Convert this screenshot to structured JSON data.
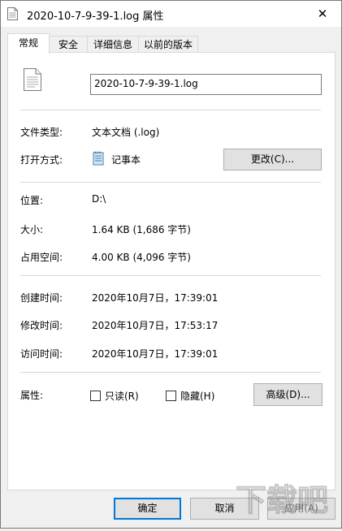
{
  "window": {
    "title": "2020-10-7-9-39-1.log 属性",
    "close_glyph": "✕"
  },
  "tabs": [
    {
      "label": "常规",
      "active": true
    },
    {
      "label": "安全",
      "active": false
    },
    {
      "label": "详细信息",
      "active": false
    },
    {
      "label": "以前的版本",
      "active": false
    }
  ],
  "general": {
    "file_name": "2020-10-7-9-39-1.log",
    "file_type_label": "文件类型:",
    "file_type_value": "文本文档 (.log)",
    "opens_with_label": "打开方式:",
    "opens_with_value": "记事本",
    "change_button": "更改(C)...",
    "location_label": "位置:",
    "location_value": "D:\\",
    "size_label": "大小:",
    "size_value": "1.64 KB (1,686 字节)",
    "size_on_disk_label": "占用空间:",
    "size_on_disk_value": "4.00 KB (4,096 字节)",
    "created_label": "创建时间:",
    "created_value": "2020年10月7日，17:39:01",
    "modified_label": "修改时间:",
    "modified_value": "2020年10月7日，17:53:17",
    "accessed_label": "访问时间:",
    "accessed_value": "2020年10月7日，17:39:01",
    "attributes_label": "属性:",
    "readonly_label": "只读(R)",
    "readonly_checked": false,
    "hidden_label": "隐藏(H)",
    "hidden_checked": false,
    "advanced_button": "高级(D)..."
  },
  "footer": {
    "ok_button": "确定",
    "cancel_button": "取消",
    "apply_button": "应用(A)"
  },
  "watermark_text": "下载吧",
  "icons": {
    "file": "file-icon",
    "notepad": "notepad-icon",
    "close": "close-icon"
  },
  "colors": {
    "focus_border": "#0078d7",
    "button_bg": "#e1e1e1",
    "panel_bg": "#ffffff",
    "window_bg": "#f0f0f0"
  }
}
